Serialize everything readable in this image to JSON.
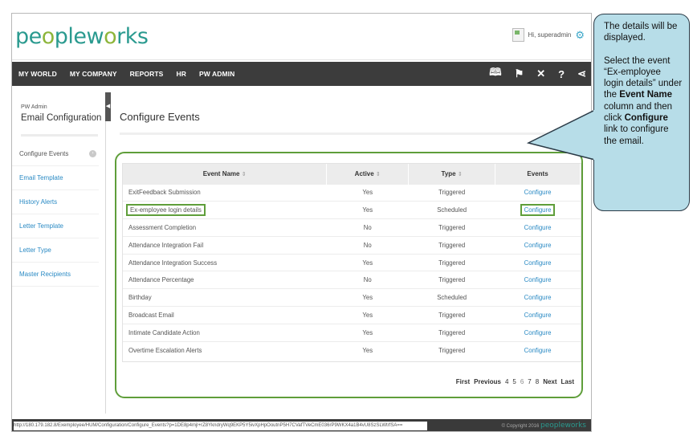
{
  "header": {
    "logo_text": "peopleworks",
    "user_greeting": "Hi, superadmin"
  },
  "nav": {
    "items": [
      "MY WORLD",
      "MY COMPANY",
      "REPORTS",
      "HR",
      "PW ADMIN"
    ],
    "icons": [
      "book-icon",
      "flag-icon",
      "tools-icon",
      "help-icon",
      "share-icon"
    ]
  },
  "sidebar": {
    "crumb": "PW Admin",
    "title": "Email Configuration",
    "items": [
      {
        "label": "Configure Events",
        "active": true
      },
      {
        "label": "Email Template"
      },
      {
        "label": "History Alerts"
      },
      {
        "label": "Letter Template"
      },
      {
        "label": "Letter Type"
      },
      {
        "label": "Master Recipients"
      }
    ]
  },
  "main": {
    "title": "Configure Events",
    "table": {
      "columns": [
        "Event Name",
        "Active",
        "Type",
        "Events"
      ],
      "rows": [
        {
          "name": "ExitFeedback Submission",
          "active": "Yes",
          "type": "Triggered",
          "action": "Configure"
        },
        {
          "name": "Ex-employee login details",
          "active": "Yes",
          "type": "Scheduled",
          "action": "Configure",
          "highlight": true
        },
        {
          "name": "Assessment Completion",
          "active": "No",
          "type": "Triggered",
          "action": "Configure"
        },
        {
          "name": "Attendance Integration Fail",
          "active": "No",
          "type": "Triggered",
          "action": "Configure"
        },
        {
          "name": "Attendance Integration Success",
          "active": "Yes",
          "type": "Triggered",
          "action": "Configure"
        },
        {
          "name": "Attendance Percentage",
          "active": "No",
          "type": "Triggered",
          "action": "Configure"
        },
        {
          "name": "Birthday",
          "active": "Yes",
          "type": "Scheduled",
          "action": "Configure"
        },
        {
          "name": "Broadcast Email",
          "active": "Yes",
          "type": "Triggered",
          "action": "Configure"
        },
        {
          "name": "Intimate Candidate Action",
          "active": "Yes",
          "type": "Triggered",
          "action": "Configure"
        },
        {
          "name": "Overtime Escalation Alerts",
          "active": "Yes",
          "type": "Triggered",
          "action": "Configure"
        }
      ]
    },
    "pager": {
      "first": "First",
      "previous": "Previous",
      "pages": [
        "4",
        "5",
        "6",
        "7",
        "8"
      ],
      "current": "6",
      "next": "Next",
      "last": "Last"
    }
  },
  "statusbar": {
    "url": "http://180.179.182.8/Exemployee/HUM/Configuration/Configure_Events?p=1DE8p4mjl+rZ8YkndryWq9EKP5Y5ivXpHpOoutnP5H7CVafTVeCmE036rP9WKX4a1B4vU8SzSLWtrfSA==",
    "copyright": "© Copyright 2016",
    "footer_logo": "peopleworks"
  },
  "callout": {
    "p1": "The details will be displayed.",
    "p2_a": "Select the event “Ex-employee login details” under the ",
    "p2_b": "Event Name",
    "p2_c": " column and then click ",
    "p2_d": "Configure",
    "p2_e": " link to configure the email."
  },
  "colors": {
    "nav_bg": "#3c3c3c",
    "link": "#2a8ac4",
    "highlight": "#5f9e3a",
    "callout_bg": "#b7dde8",
    "logo_teal": "#2a9a8f",
    "logo_green": "#8db53a"
  }
}
